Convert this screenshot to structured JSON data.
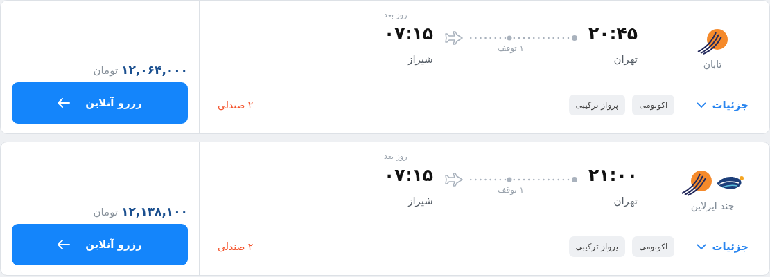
{
  "flights": [
    {
      "airline": {
        "name": "تابان",
        "logos": [
          {
            "kind": "swoosh"
          }
        ]
      },
      "departure": {
        "time": "۲۰:۴۵",
        "city": "تهران"
      },
      "arrival": {
        "time": "۰۷:۱۵",
        "city": "شیراز",
        "note": "روز بعد"
      },
      "stops": "۱ توقف",
      "details": "جزئیات",
      "tags": [
        "اکونومی",
        "پرواز ترکیبی"
      ],
      "seats": "۲ صندلی",
      "price": "۱۲,۰۶۴,۰۰۰",
      "currency": "تومان",
      "book": "رزرو آنلاین"
    },
    {
      "airline": {
        "name": "چند ایرلاین",
        "logos": [
          {
            "kind": "wave"
          },
          {
            "kind": "swoosh"
          }
        ]
      },
      "departure": {
        "time": "۲۱:۰۰",
        "city": "تهران"
      },
      "arrival": {
        "time": "۰۷:۱۵",
        "city": "شیراز",
        "note": "روز بعد"
      },
      "stops": "۱ توقف",
      "details": "جزئیات",
      "tags": [
        "اکونومی",
        "پرواز ترکیبی"
      ],
      "seats": "۲ صندلی",
      "price": "۱۲,۱۳۸,۱۰۰",
      "currency": "تومان",
      "book": "رزرو آنلاین"
    }
  ]
}
